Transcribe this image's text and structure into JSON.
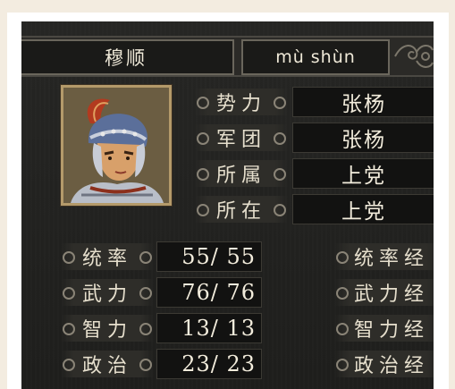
{
  "character": {
    "name": "穆顺",
    "pinyin": "mù shùn"
  },
  "info_rows": [
    {
      "label": "势力",
      "value": "张杨"
    },
    {
      "label": "军团",
      "value": "张杨"
    },
    {
      "label": "所属",
      "value": "上党"
    },
    {
      "label": "所在",
      "value": "上党"
    }
  ],
  "stats": [
    {
      "label": "统率",
      "value": "55/ 55",
      "exp_label": "统率经"
    },
    {
      "label": "武力",
      "value": "76/ 76",
      "exp_label": "武力经"
    },
    {
      "label": "智力",
      "value": "13/ 13",
      "exp_label": "智力经"
    },
    {
      "label": "政治",
      "value": "23/ 23",
      "exp_label": "政治经"
    }
  ],
  "portrait": {
    "icon": "general-portrait-icon"
  }
}
